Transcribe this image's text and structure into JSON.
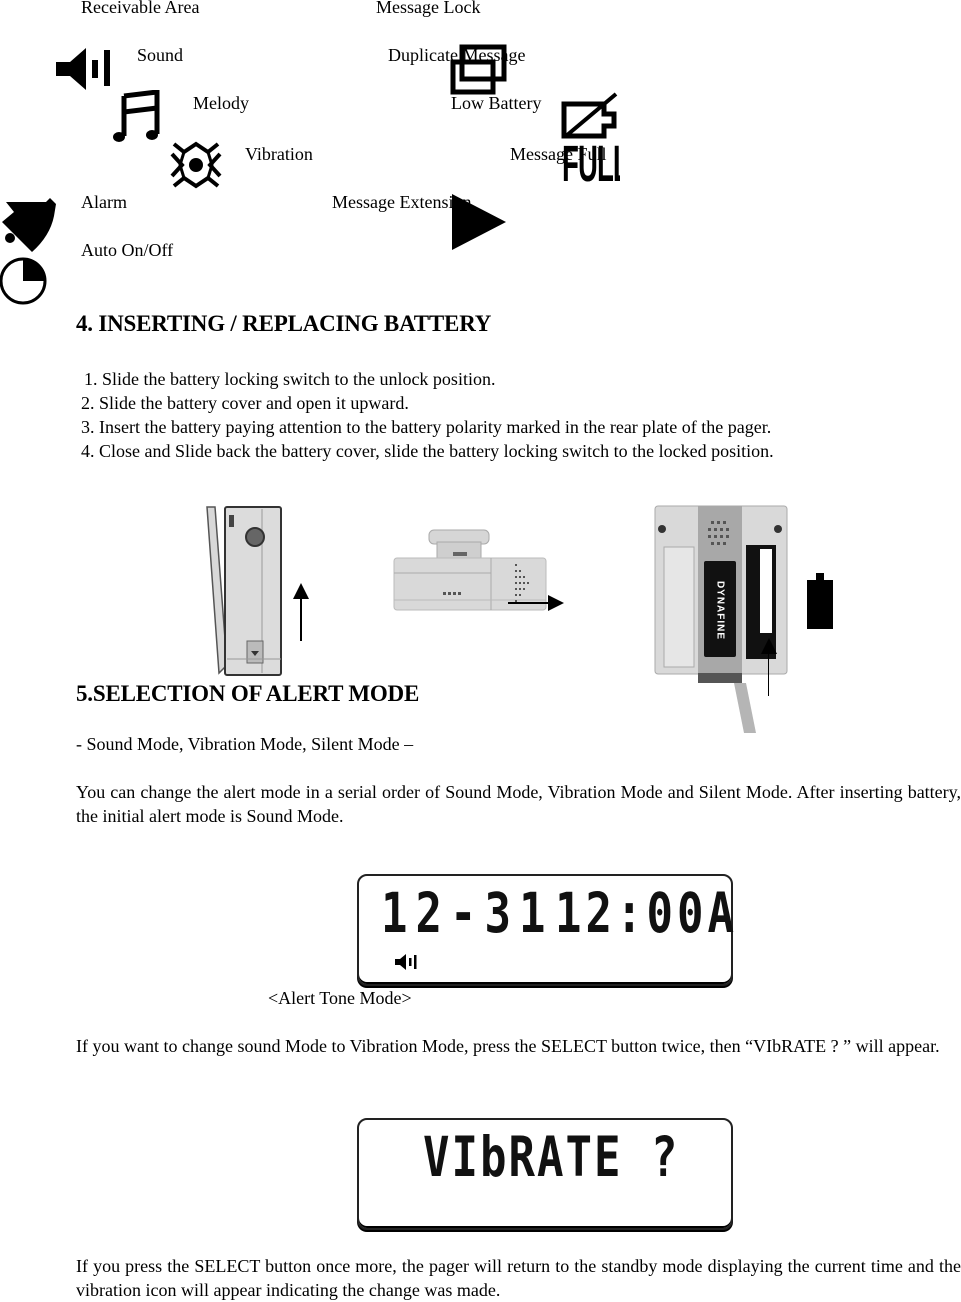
{
  "icon_legend": {
    "left": [
      {
        "label": "Receivable Area",
        "icon": "receivable-area"
      },
      {
        "label": "Sound",
        "icon": "speaker-icon"
      },
      {
        "label": "Melody",
        "icon": "music-note-icon"
      },
      {
        "label": "Vibration",
        "icon": "vibration-icon"
      },
      {
        "label": "Alarm",
        "icon": "alarm-bell-icon"
      },
      {
        "label": "Auto On/Off",
        "icon": "clock-icon"
      }
    ],
    "right": [
      {
        "label": "Message Lock",
        "icon": "lock"
      },
      {
        "label": "Duplicate Message",
        "icon": "duplicate-message-icon"
      },
      {
        "label": "Low Battery",
        "icon": "low-battery-icon"
      },
      {
        "label": "Message Full",
        "icon": "full-icon",
        "icon_text": "FULL"
      },
      {
        "label": "Message Extension",
        "icon": "play-arrow-icon"
      }
    ]
  },
  "section4": {
    "heading": "4. INSERTING / REPLACING BATTERY",
    "steps": [
      "1. Slide the battery locking switch to the unlock position.",
      "2. Slide the battery cover and open it upward.",
      "3. Insert the battery paying attention to the battery polarity marked in the rear plate of the pager.",
      "4. Close and Slide back the battery cover, slide the battery locking switch to the locked position."
    ],
    "figure_brand": "DYNAFINE"
  },
  "section5": {
    "heading": "5.SELECTION OF ALERT MODE",
    "modes_line": "- Sound Mode, Vibration Mode, Silent Mode –",
    "intro": "You can change the alert mode in a serial order of Sound Mode, Vibration Mode and Silent Mode. After inserting battery, the initial alert mode is Sound Mode.",
    "display1": {
      "date": "12-31",
      "time": "12:00A",
      "caption": "<Alert Tone Mode>"
    },
    "change_instruction": "If you want to change sound Mode to Vibration  Mode, press the SELECT button twice, then “VIbRATE ? ” will appear.",
    "display2": {
      "text": "VIbRATE ?"
    },
    "closing": "If you press the SELECT button once more, the pager will return to the standby mode displaying the current time and the vibration icon will appear indicating the change was made."
  }
}
